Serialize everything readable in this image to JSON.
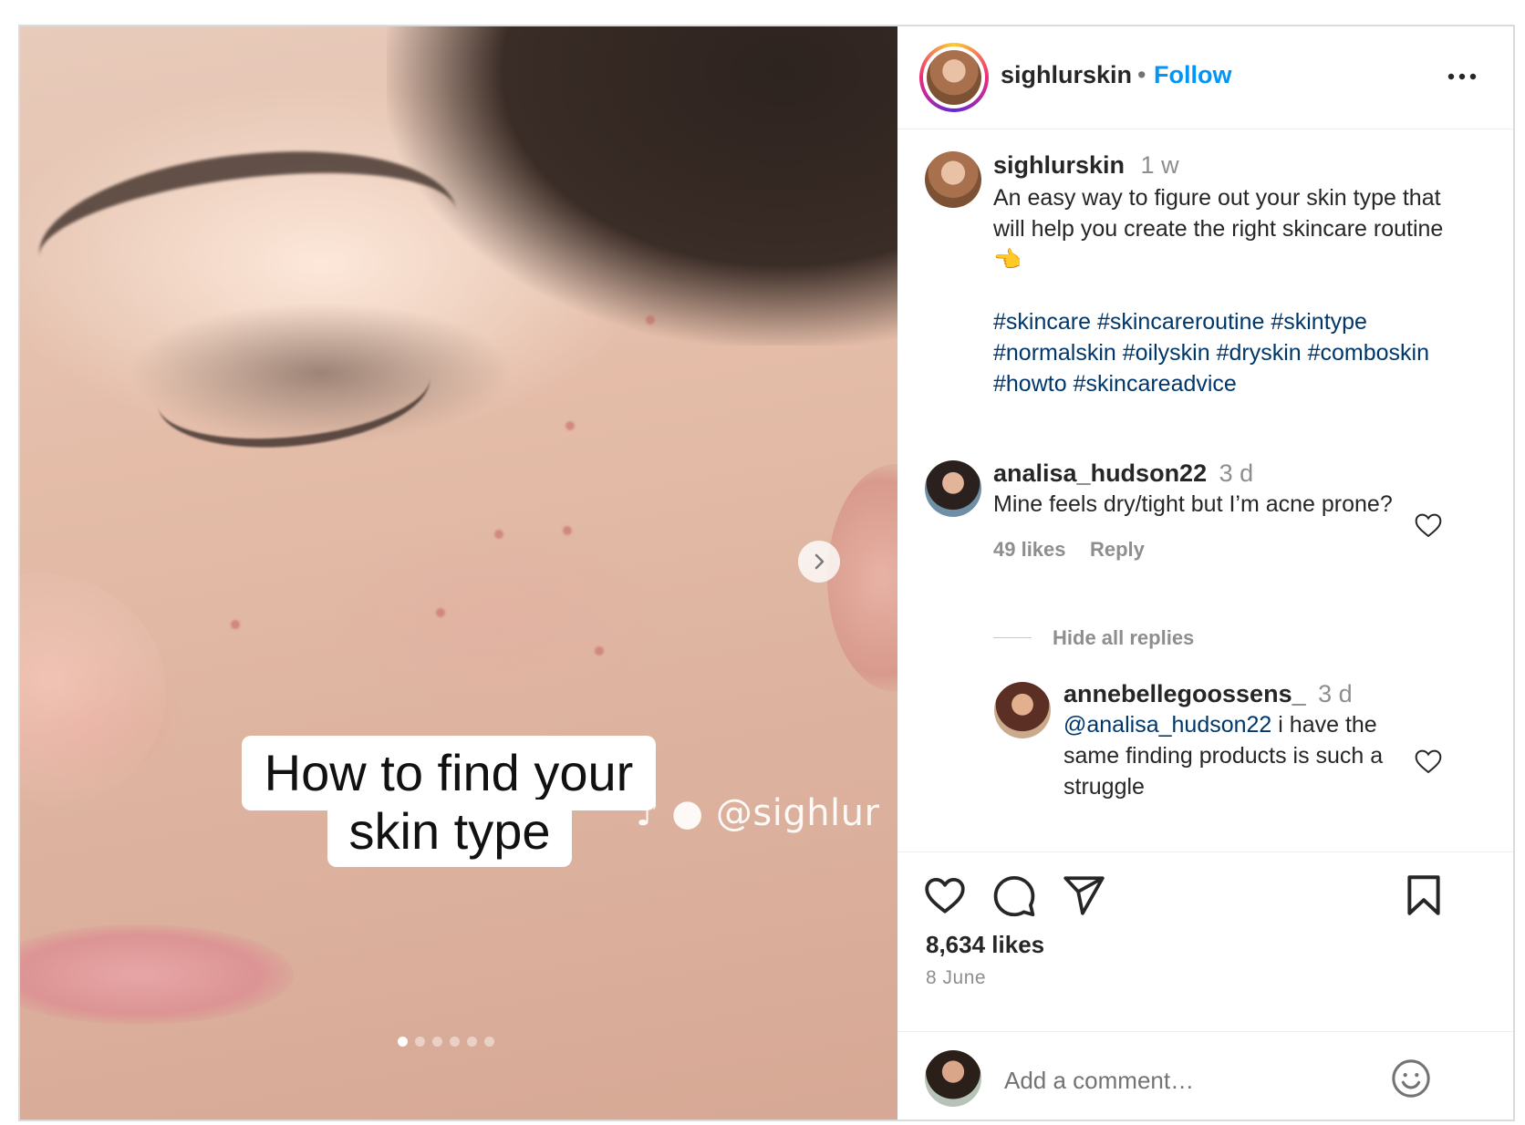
{
  "post": {
    "image_caption": [
      "How to find your",
      "skin type"
    ],
    "watermark": "♪ ● @sighlur",
    "carousel_dots": 6,
    "carousel_active_index": 0,
    "author": {
      "username": "sighlurskin",
      "separator": "•",
      "follow_label": "Follow"
    },
    "caption": {
      "username": "sighlurskin",
      "time": "1 w",
      "text": "An easy way to figure out your skin type that will help you create the right skincare routine 👈",
      "hashtags": [
        "#skincare",
        "#skincareroutine",
        "#skintype",
        "#normalskin",
        "#oilyskin",
        "#dryskin",
        "#comboskin",
        "#howto",
        "#skincareadvice"
      ]
    },
    "comments": [
      {
        "username": "analisa_hudson22",
        "time": "3 d",
        "text": "Mine feels dry/tight but I’m acne prone?",
        "likes": "49 likes",
        "reply_label": "Reply",
        "toggle_replies": "Hide all replies",
        "replies": [
          {
            "username": "annebellegoossens_",
            "time": "3 d",
            "mention": "@analisa_hudson22",
            "text": " i have the same finding products is such a struggle"
          }
        ]
      }
    ],
    "likes_count": "8,634 likes",
    "date": "8 June",
    "add_comment_placeholder": "Add a comment…"
  },
  "colors": {
    "link_blue": "#0095f6",
    "hashtag_blue": "#00376b",
    "muted": "#8e8e8e",
    "border": "#dbdbdb"
  },
  "icons": [
    "chevron-right-icon",
    "more-icon",
    "heart-icon",
    "comment-icon",
    "share-icon",
    "bookmark-icon",
    "emoji-icon"
  ]
}
